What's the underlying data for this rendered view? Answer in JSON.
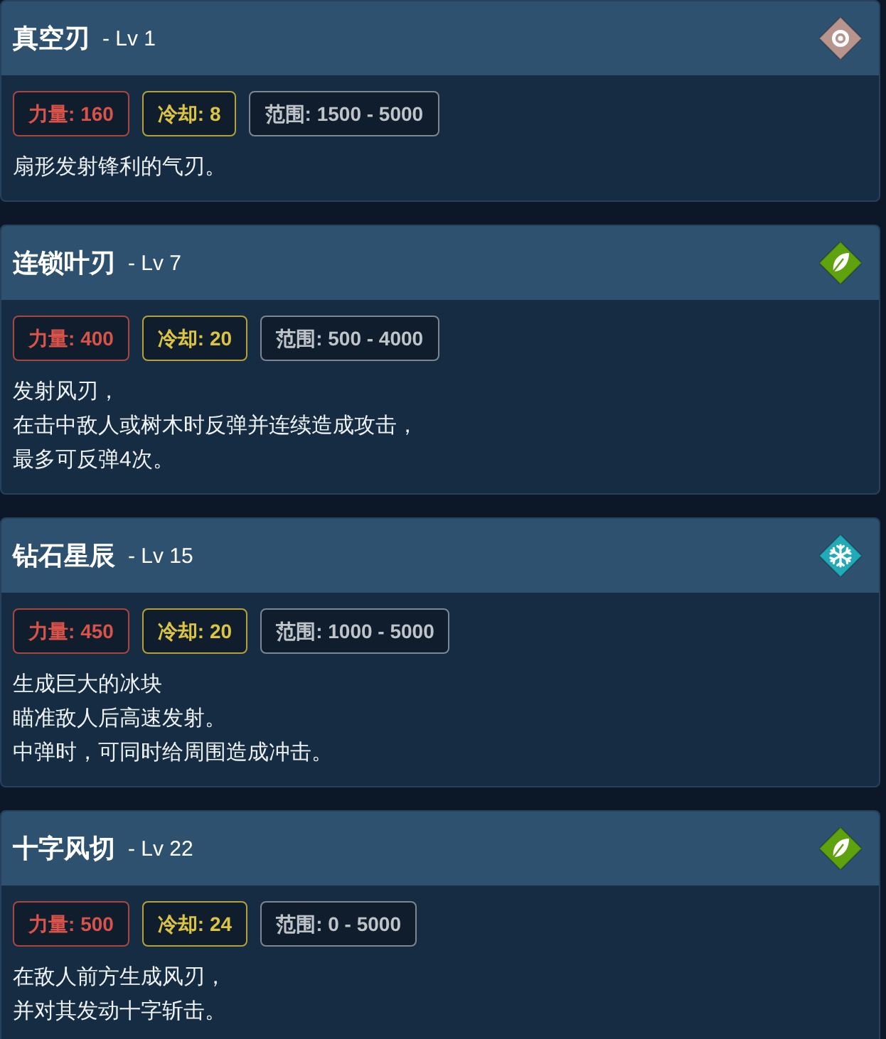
{
  "skills": [
    {
      "name": "真空刃",
      "level": "- Lv 1",
      "element": {
        "kind": "target",
        "color": "#b8958c"
      },
      "stats": [
        {
          "kind": "power",
          "label": "力量:",
          "value": "160"
        },
        {
          "kind": "cooldown",
          "label": "冷却:",
          "value": "8"
        },
        {
          "kind": "range",
          "label": "范围:",
          "value": "1500 - 5000"
        }
      ],
      "description": [
        "扇形发射锋利的气刃。"
      ]
    },
    {
      "name": "连锁叶刃",
      "level": "- Lv 7",
      "element": {
        "kind": "leaf",
        "color": "#5ea20e"
      },
      "stats": [
        {
          "kind": "power",
          "label": "力量:",
          "value": "400"
        },
        {
          "kind": "cooldown",
          "label": "冷却:",
          "value": "20"
        },
        {
          "kind": "range",
          "label": "范围:",
          "value": "500 - 4000"
        }
      ],
      "description": [
        "发射风刃，",
        "在击中敌人或树木时反弹并连续造成攻击，",
        "最多可反弹4次。"
      ]
    },
    {
      "name": "钻石星辰",
      "level": "- Lv 15",
      "element": {
        "kind": "snowflake",
        "color": "#22aab8"
      },
      "stats": [
        {
          "kind": "power",
          "label": "力量:",
          "value": "450"
        },
        {
          "kind": "cooldown",
          "label": "冷却:",
          "value": "20"
        },
        {
          "kind": "range",
          "label": "范围:",
          "value": "1000 - 5000"
        }
      ],
      "description": [
        "生成巨大的冰块",
        "瞄准敌人后高速发射。",
        "中弹时，可同时给周围造成冲击。"
      ]
    },
    {
      "name": "十字风切",
      "level": "- Lv 22",
      "element": {
        "kind": "leaf",
        "color": "#5ea20e"
      },
      "stats": [
        {
          "kind": "power",
          "label": "力量:",
          "value": "500"
        },
        {
          "kind": "cooldown",
          "label": "冷却:",
          "value": "24"
        },
        {
          "kind": "range",
          "label": "范围:",
          "value": "0 - 5000"
        }
      ],
      "description": [
        "在敌人前方生成风刃，",
        "并对其发动十字斩击。"
      ]
    }
  ]
}
